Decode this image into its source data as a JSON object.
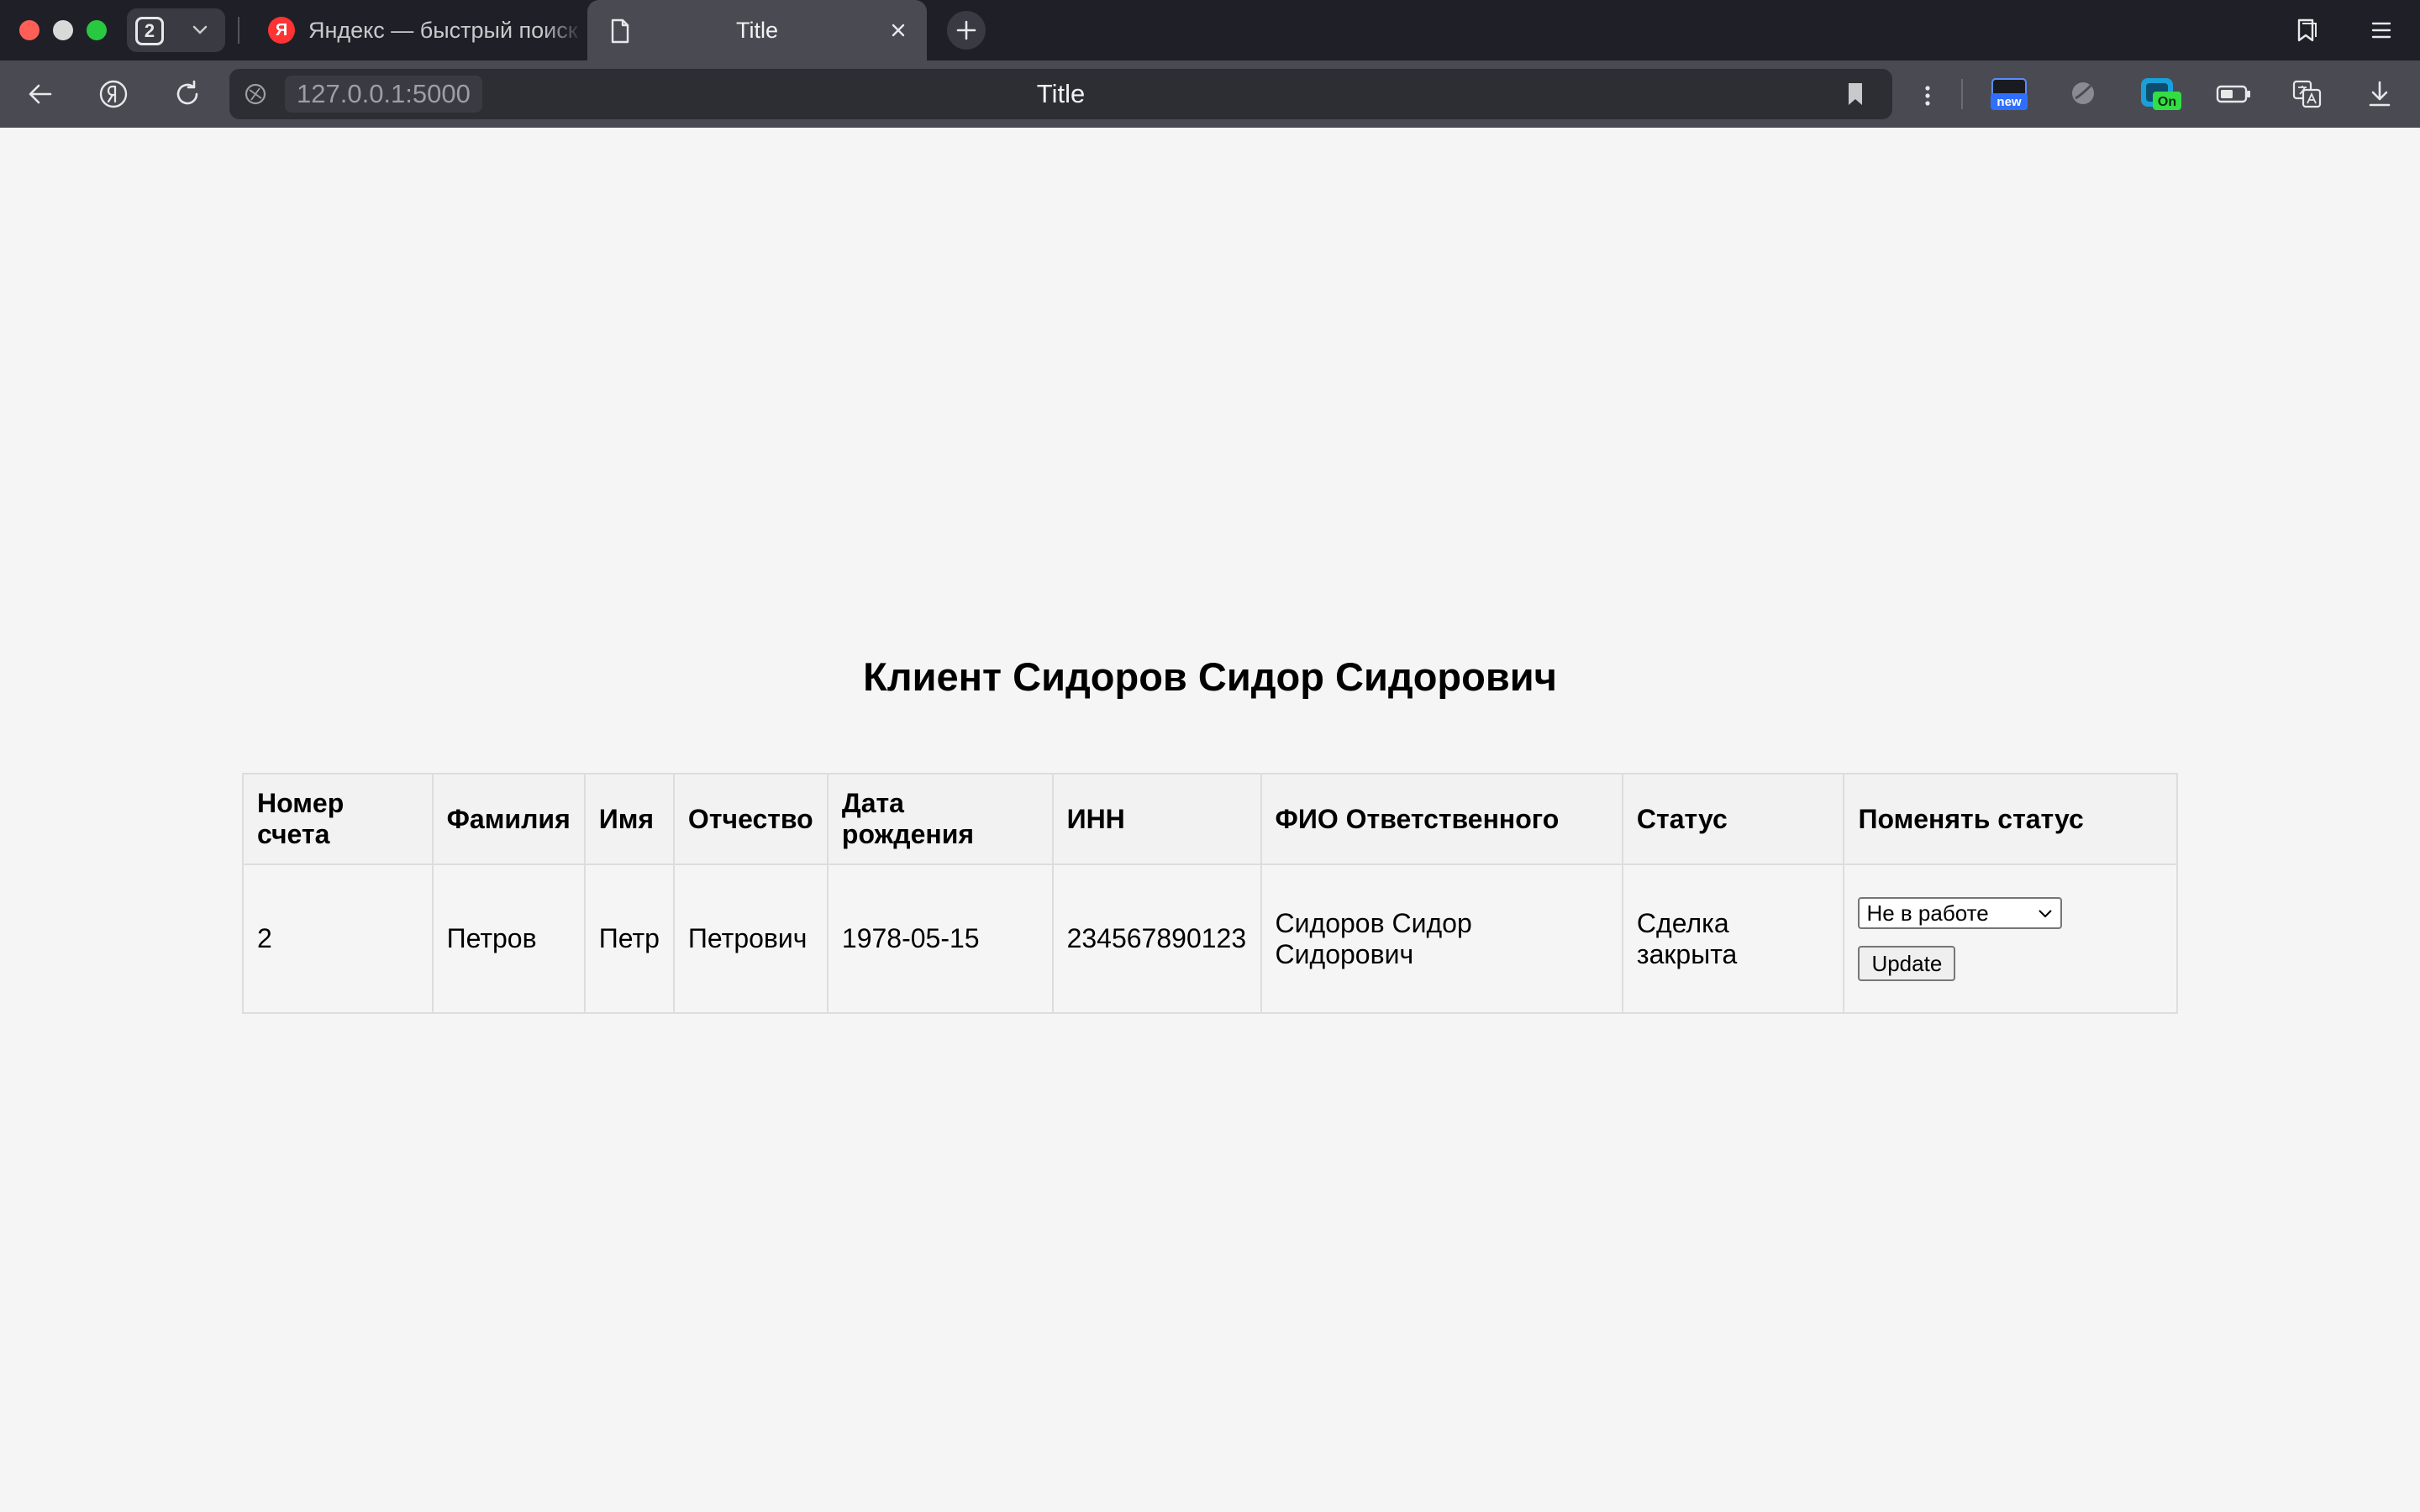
{
  "browser": {
    "tab_count": "2",
    "tabs": [
      {
        "title": "Яндекс — быстрый поиск в интернете",
        "favicon": "yandex-icon",
        "active": false
      },
      {
        "title": "Title",
        "favicon": "page-icon",
        "active": true
      }
    ],
    "address": {
      "url": "127.0.0.1:5000",
      "page_title": "Title"
    },
    "extensions": [
      {
        "name": "new-badge-extension-icon",
        "badge": "new"
      },
      {
        "name": "moon-extension-icon"
      },
      {
        "name": "on-badge-extension-icon",
        "badge": "On"
      },
      {
        "name": "battery-icon"
      },
      {
        "name": "translate-icon"
      },
      {
        "name": "download-icon"
      }
    ],
    "colors": {
      "tabbar_bg": "#1f2027",
      "toolbar_bg": "#4a4b52",
      "addressbar_bg": "#2d2e34"
    }
  },
  "page": {
    "heading": "Клиент Сидоров Сидор Сидорович",
    "table": {
      "headers": [
        "Номер счета",
        "Фамилия",
        "Имя",
        "Отчество",
        "Дата рождения",
        "ИНН",
        "ФИО Ответственного",
        "Статус",
        "Поменять статус"
      ],
      "rows": [
        {
          "account_number": "2",
          "last_name": "Петров",
          "first_name": "Петр",
          "patronymic": "Петрович",
          "birth_date": "1978-05-15",
          "inn": "234567890123",
          "responsible": "Сидоров Сидор Сидорович",
          "status": "Сделка закрыта",
          "status_select": "Не в работе",
          "update_label": "Update"
        }
      ]
    }
  }
}
